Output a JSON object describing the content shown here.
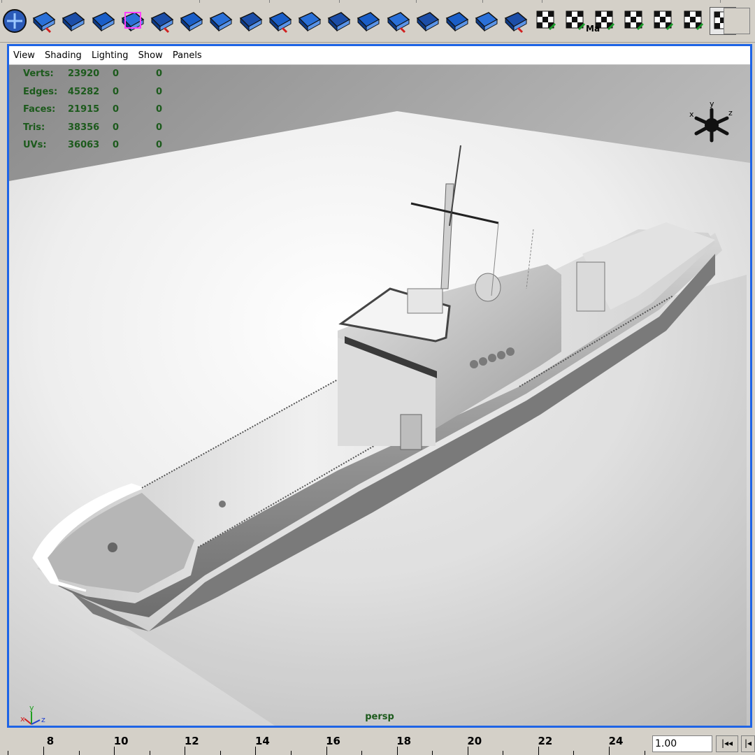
{
  "shelf": {
    "tools": [
      {
        "icon": "bridge-icon"
      },
      {
        "icon": "poly-create-icon"
      },
      {
        "icon": "poly-sphere-icon"
      },
      {
        "icon": "poly-combine-icon"
      },
      {
        "icon": "poly-cube-icon"
      },
      {
        "icon": "poly-plane-icon"
      },
      {
        "icon": "poly-select-icon"
      },
      {
        "icon": "extrude-face-icon"
      },
      {
        "icon": "extrude-edge-icon"
      },
      {
        "icon": "bevel-icon"
      },
      {
        "icon": "split-poly-icon"
      },
      {
        "icon": "merge-vertex-icon"
      },
      {
        "icon": "append-poly-icon"
      },
      {
        "icon": "cut-faces-icon"
      },
      {
        "icon": "split-edge-icon"
      },
      {
        "icon": "wedge-face-icon"
      },
      {
        "icon": "duplicate-face-icon"
      },
      {
        "icon": "extract-icon"
      },
      {
        "icon": "sculpt-icon"
      },
      {
        "icon": "planar-map-icon"
      },
      {
        "icon": "uv-map-label-icon"
      },
      {
        "icon": "cylindrical-map-icon"
      },
      {
        "icon": "spherical-map-icon"
      },
      {
        "icon": "texture-map-icon"
      },
      {
        "icon": "uv-editor-icon"
      }
    ],
    "map_label": "Ma"
  },
  "viewport": {
    "menu": [
      "View",
      "Shading",
      "Lighting",
      "Show",
      "Panels"
    ],
    "hud": [
      {
        "label": "Verts:",
        "v1": "23920",
        "v2": "0",
        "v3": "0"
      },
      {
        "label": "Edges:",
        "v1": "45282",
        "v2": "0",
        "v3": "0"
      },
      {
        "label": "Faces:",
        "v1": "21915",
        "v2": "0",
        "v3": "0"
      },
      {
        "label": "Tris:",
        "v1": "38356",
        "v2": "0",
        "v3": "0"
      },
      {
        "label": "UVs:",
        "v1": "36063",
        "v2": "0",
        "v3": "0"
      }
    ],
    "camera": "persp",
    "view_cube": {
      "x": "x",
      "y": "y",
      "z": "z"
    },
    "axis": {
      "x": "x",
      "y": "y",
      "z": "z"
    }
  },
  "timeline": {
    "labels": [
      "8",
      "10",
      "12",
      "14",
      "16",
      "18",
      "20",
      "22",
      "24"
    ],
    "current_frame": "1.00",
    "rewind": "|◂◂",
    "step_back": "|◂"
  },
  "colors": {
    "panel_border": "#1e64e6",
    "hud_text": "#1c5a1c",
    "icon_blue": "#1a5ec8"
  }
}
